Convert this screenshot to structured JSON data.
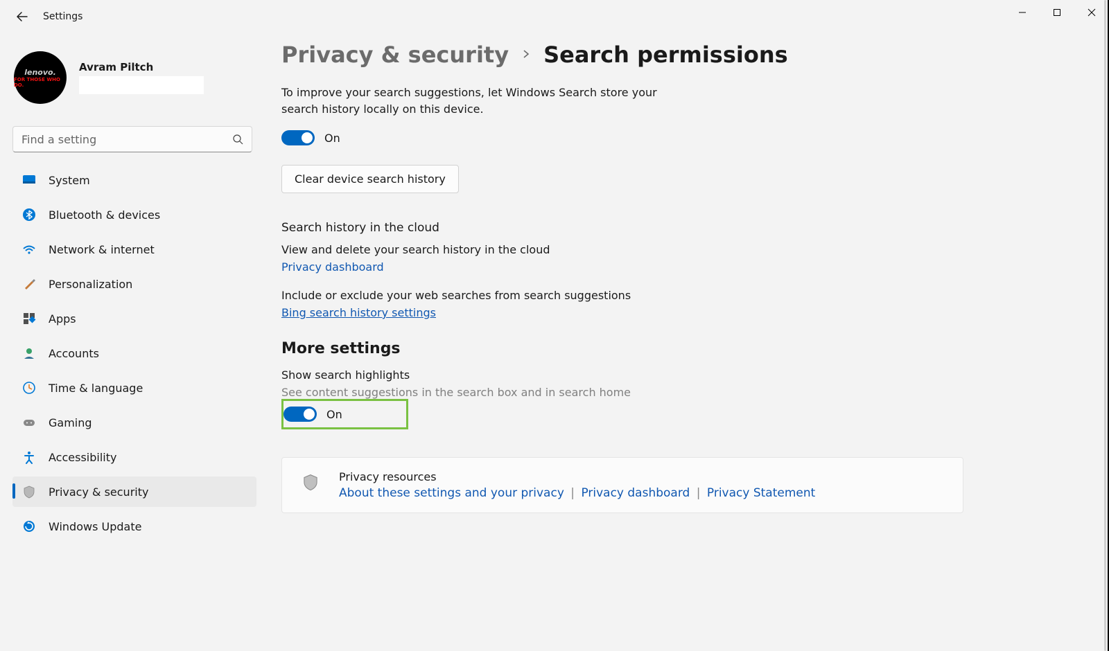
{
  "app_title": "Settings",
  "user": {
    "name": "Avram Piltch"
  },
  "search": {
    "placeholder": "Find a setting"
  },
  "nav": [
    {
      "label": "System"
    },
    {
      "label": "Bluetooth & devices"
    },
    {
      "label": "Network & internet"
    },
    {
      "label": "Personalization"
    },
    {
      "label": "Apps"
    },
    {
      "label": "Accounts"
    },
    {
      "label": "Time & language"
    },
    {
      "label": "Gaming"
    },
    {
      "label": "Accessibility"
    },
    {
      "label": "Privacy & security"
    },
    {
      "label": "Windows Update"
    }
  ],
  "breadcrumb": {
    "parent": "Privacy & security",
    "current": "Search permissions"
  },
  "history_local": {
    "desc": "To improve your search suggestions, let Windows Search store your search history locally on this device.",
    "toggle_state": "On",
    "clear_button": "Clear device search history"
  },
  "cloud": {
    "heading": "Search history in the cloud",
    "line1": "View and delete your search history in the cloud",
    "link1": "Privacy dashboard",
    "line2": "Include or exclude your web searches from search suggestions",
    "link2": "Bing search history settings"
  },
  "more": {
    "heading": "More settings",
    "highlights_title": "Show search highlights",
    "highlights_sub": "See content suggestions in the search box and in search home",
    "highlights_state": "On"
  },
  "resources": {
    "title": "Privacy resources",
    "link1": "About these settings and your privacy",
    "link2": "Privacy dashboard",
    "link3": "Privacy Statement"
  }
}
